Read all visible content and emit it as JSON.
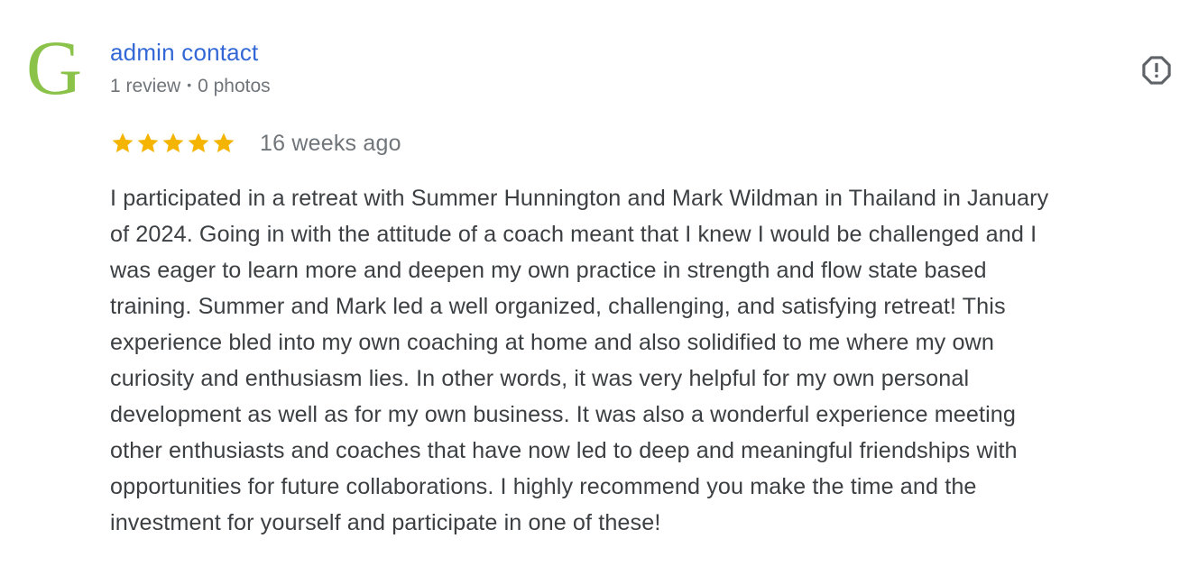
{
  "review": {
    "avatar": {
      "letter": "G",
      "color": "#8bc34a"
    },
    "author": {
      "name": "admin contact",
      "reviews_count": "1 review",
      "separator": "•",
      "photos_count": "0 photos"
    },
    "flag_icon": "flag-report-icon",
    "rating": {
      "stars": 5,
      "max_stars": 5,
      "star_color": "#f4b400"
    },
    "posted_time": "16 weeks ago",
    "text": "I participated in a retreat with Summer Hunnington and Mark Wildman in Thailand in January\nof 2024. Going in with the attitude of a coach meant that I knew I would be challenged and I\nwas eager to learn more and deepen my own practice in strength and flow state based\ntraining. Summer and Mark led a well organized, challenging, and satisfying retreat! This\nexperience bled into my own coaching at home and also solidified to me where my own\ncuriosity and enthusiasm lies. In other words, it was very helpful for my own personal\ndevelopment as well as for my own business. It was also a wonderful experience meeting\nother enthusiasts and coaches that have now led to deep and meaningful friendships with\nopportunities for future collaborations. I highly recommend you make the time and the\ninvestment for yourself and participate in one of these!"
  }
}
